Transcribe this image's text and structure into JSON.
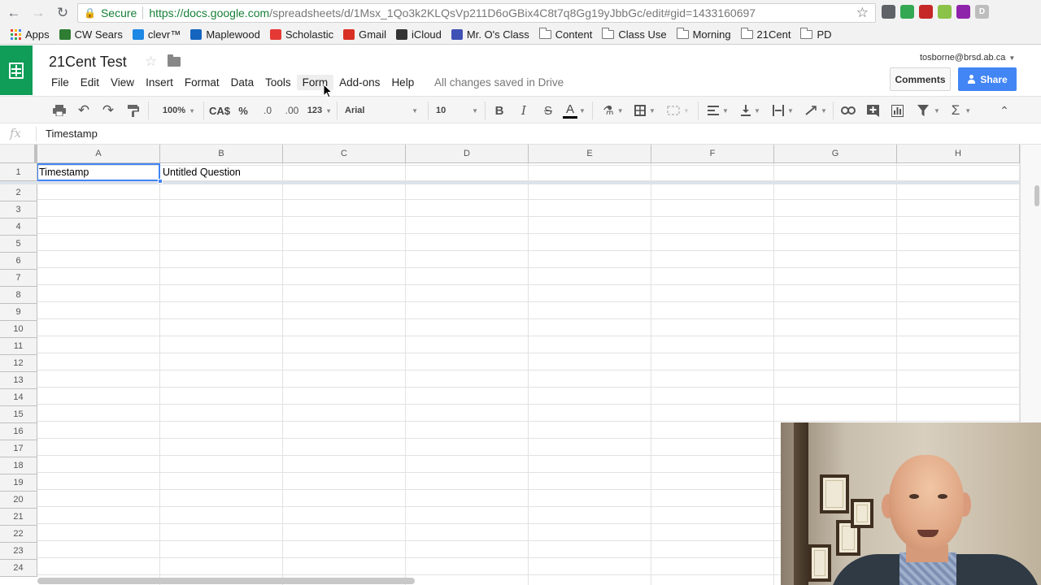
{
  "browser": {
    "secure_label": "Secure",
    "url_host": "https://docs.google.com",
    "url_path": "/spreadsheets/d/1Msx_1Qo3k2KLQsVp211D6oGBix4C8t7q8Gg19yJbbGc/edit#gid=1433160697",
    "bookmarks": [
      {
        "label": "Apps",
        "icon": "apps-grid-icon",
        "color": "#e94235"
      },
      {
        "label": "CW Sears",
        "icon": "bird-icon",
        "color": "#2e7d32"
      },
      {
        "label": "clevr™",
        "icon": "clever-icon",
        "color": "#1e88e5"
      },
      {
        "label": "Maplewood",
        "icon": "maplewood-icon",
        "color": "#1565c0"
      },
      {
        "label": "Scholastic",
        "icon": "scholastic-icon",
        "color": "#e53935"
      },
      {
        "label": "Gmail",
        "icon": "gmail-icon",
        "color": "#d93025"
      },
      {
        "label": "iCloud",
        "icon": "apple-icon",
        "color": "#333333"
      },
      {
        "label": "Mr. O's Class",
        "icon": "site-icon",
        "color": "#3f51b5"
      },
      {
        "label": "Content",
        "icon": "folder-icon"
      },
      {
        "label": "Class Use",
        "icon": "folder-icon"
      },
      {
        "label": "Morning",
        "icon": "folder-icon"
      },
      {
        "label": "21Cent",
        "icon": "folder-icon"
      },
      {
        "label": "PD",
        "icon": "folder-icon"
      }
    ],
    "extension_colors": [
      "#5f6368",
      "#34a853",
      "#c62828",
      "#8bc34a",
      "#8e24aa",
      "#bdbdbd"
    ],
    "extension_labels": [
      "",
      "",
      "",
      "",
      "",
      "D"
    ]
  },
  "sheet": {
    "title": "21Cent Test",
    "account": "tosborne@brsd.ab.ca",
    "menu": [
      "File",
      "Edit",
      "View",
      "Insert",
      "Format",
      "Data",
      "Tools",
      "Form",
      "Add-ons",
      "Help"
    ],
    "active_menu": "Form",
    "saved_status": "All changes saved in Drive",
    "comments_label": "Comments",
    "share_label": "Share",
    "accent_color": "#0f9d58",
    "share_color": "#4285f4"
  },
  "toolbar": {
    "zoom": "100%",
    "currency": "CA$",
    "percent": "%",
    "decrease_decimal": ".0",
    "increase_decimal": ".00",
    "more_formats": "123",
    "font": "Arial",
    "font_size": "10",
    "bold": "B",
    "italic": "I",
    "strike": "S",
    "text_color": "A"
  },
  "formula_bar": {
    "fx": "fx",
    "value": "Timestamp"
  },
  "grid": {
    "columns": [
      "A",
      "B",
      "C",
      "D",
      "E",
      "F",
      "G",
      "H"
    ],
    "rows": [
      "1",
      "2",
      "3",
      "4",
      "5",
      "6",
      "7",
      "8",
      "9",
      "10",
      "11",
      "12",
      "13",
      "14",
      "15",
      "16",
      "17",
      "18",
      "19",
      "20",
      "21",
      "22",
      "23",
      "24"
    ],
    "row1": [
      "Timestamp",
      "Untitled Question"
    ],
    "selected_cell": "A1"
  }
}
